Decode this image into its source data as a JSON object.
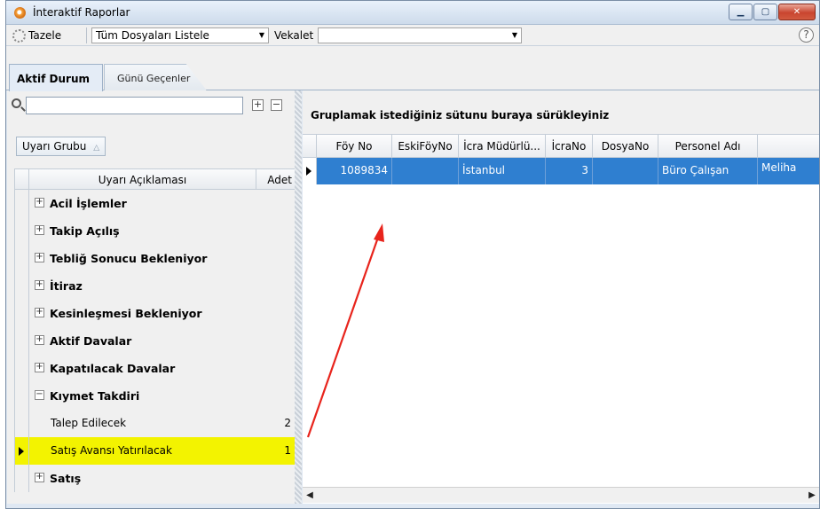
{
  "window": {
    "title": "İnteraktif Raporlar",
    "btn_minimize": "▁",
    "btn_maximize": "▢",
    "btn_close": "✕"
  },
  "toolbar": {
    "refresh_label": "Tazele",
    "list_combo_value": "Tüm Dosyaları Listele",
    "vekalet_label": "Vekalet",
    "vekalet_value": "",
    "help_label": "?"
  },
  "tabs": [
    {
      "label": "Aktif Durum"
    },
    {
      "label": "Günü Geçenler"
    }
  ],
  "left": {
    "search_value": "",
    "expand_all": "+",
    "collapse_all": "−",
    "group_button": "Uyarı Grubu",
    "group_button_sort": "△",
    "col_desc": "Uyarı Açıklaması",
    "col_count": "Adet",
    "expand_symbol": "+",
    "collapse_symbol": "−",
    "groups": [
      {
        "label": "Acil İşlemler"
      },
      {
        "label": "Takip Açılış"
      },
      {
        "label": "Tebliğ Sonucu Bekleniyor"
      },
      {
        "label": "İtiraz"
      },
      {
        "label": "Kesinleşmesi Bekleniyor"
      },
      {
        "label": "Aktif Davalar"
      },
      {
        "label": "Kapatılacak Davalar"
      },
      {
        "label": "Kıymet Takdiri"
      },
      {
        "label": "Satış"
      }
    ],
    "leaves": [
      {
        "label": "Talep Edilecek",
        "count": "2"
      },
      {
        "label": "Satış Avansı Yatırılacak",
        "count": "1"
      }
    ]
  },
  "right": {
    "group_drop_hint": "Gruplamak istediğiniz sütunu buraya sürükleyiniz",
    "columns": [
      "Föy No",
      "EskiFöyNo",
      "İcra Müdürlü...",
      "İcraNo",
      "DosyaNo",
      "Personel Adı",
      ""
    ],
    "row": [
      "1089834",
      "",
      "İstanbul",
      "3",
      "",
      "Büro Çalışan",
      "Meliha"
    ],
    "scroll_left": "◀",
    "scroll_right": "▶"
  },
  "colors": {
    "selected_row": "#2f7fd0",
    "highlight_row": "#f3f300",
    "annotation_arrow": "#e8241c"
  }
}
